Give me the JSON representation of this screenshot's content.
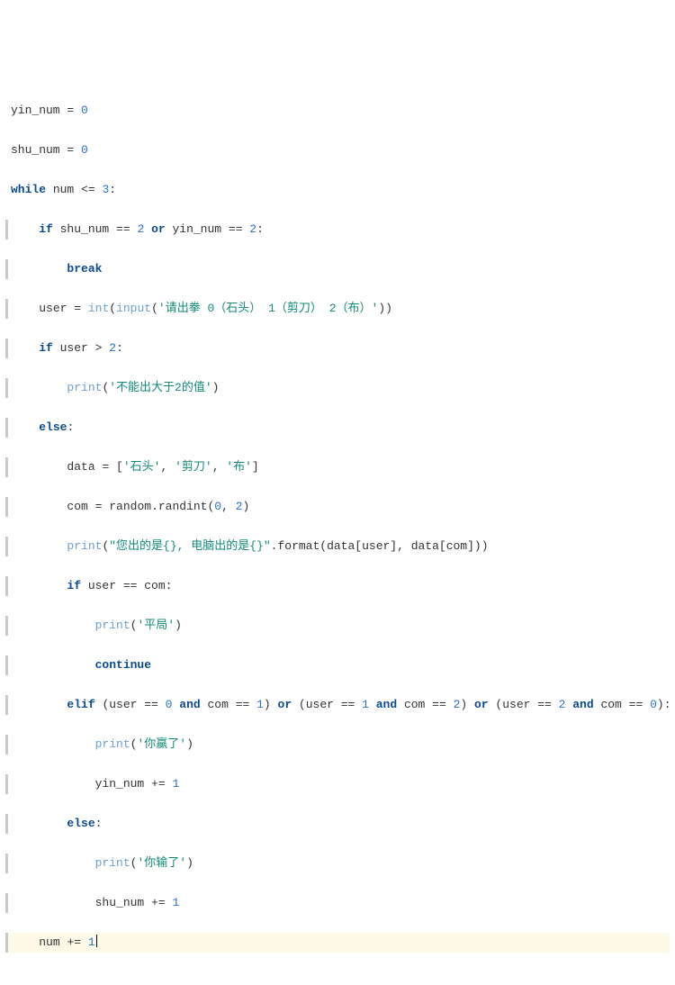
{
  "code": {
    "l0_yin": "yin_num ",
    "l0_eq": "= ",
    "l0_zero": "0",
    "l1_shu": "shu_num ",
    "l1_eq": "= ",
    "l1_zero": "0",
    "l2_while": "while",
    "l2_cond": " num ",
    "l2_le": "<=",
    "l2_num": " 3",
    "l2_colon": ":",
    "l3_if": "if",
    "l3_a": " shu_num ",
    "l3_eqeq1": "==",
    "l3_two1": " 2 ",
    "l3_or": "or",
    "l3_b": " yin_num ",
    "l3_eqeq2": "==",
    "l3_two2": " 2",
    "l3_colon": ":",
    "l4_break": "break",
    "l5_user": "user ",
    "l5_eq": "= ",
    "l5_int": "int",
    "l5_po": "(",
    "l5_input": "input",
    "l5_po2": "(",
    "l5_s": "'请出拳 0（石头） 1（剪刀） 2（布）'",
    "l5_pc": "))",
    "l6_if": "if",
    "l6_cond": " user ",
    "l6_gt": ">",
    "l6_two": " 2",
    "l6_colon": ":",
    "l7_print": "print",
    "l7_po": "(",
    "l7_s": "'不能出大于2的值'",
    "l7_pc": ")",
    "l8_else": "else",
    "l8_colon": ":",
    "l9_data": "data ",
    "l9_eq": "= ",
    "l9_lb": "[",
    "l9_s1": "'石头'",
    "l9_c1": ", ",
    "l9_s2": "'剪刀'",
    "l9_c2": ", ",
    "l9_s3": "'布'",
    "l9_rb": "]",
    "l10_com": "com ",
    "l10_eq": "= ",
    "l10_rand": "random.randint(",
    "l10_z": "0",
    "l10_c": ", ",
    "l10_t": "2",
    "l10_pc": ")",
    "l11_print": "print",
    "l11_po": "(",
    "l11_s": "\"您出的是{}, 电脑出的是{}\"",
    "l11_fmt": ".format(data[user], data[com]))",
    "l12_if": "if",
    "l12_cond": " user ",
    "l12_eqeq": "==",
    "l12_com": " com",
    "l12_colon": ":",
    "l13_print": "print",
    "l13_po": "(",
    "l13_s": "'平局'",
    "l13_pc": ")",
    "l14_continue": "continue",
    "l15_elif": "elif",
    "l15_a": " (user ",
    "l15_eq1": "==",
    "l15_z1": " 0 ",
    "l15_and1": "and",
    "l15_b": " com ",
    "l15_eq2": "==",
    "l15_o1": " 1",
    "l15_p1": ") ",
    "l15_or1": "or",
    "l15_c": " (user ",
    "l15_eq3": "==",
    "l15_o2": " 1 ",
    "l15_and2": "and",
    "l15_d": " com ",
    "l15_eq4": "==",
    "l15_t2": " 2",
    "l15_p2": ") ",
    "l15_or2": "or",
    "l15_e": " (user ",
    "l15_eq5": "==",
    "l15_t3": " 2 ",
    "l15_and3": "and",
    "l15_f": " com ",
    "l15_eq6": "==",
    "l15_z2": " 0",
    "l15_p3": ")",
    "l15_colon": ":",
    "l16_print": "print",
    "l16_po": "(",
    "l16_s": "'你赢了'",
    "l16_pc": ")",
    "l17_yin": "yin_num ",
    "l17_pe": "+=",
    "l17_one": " 1",
    "l18_else": "else",
    "l18_colon": ":",
    "l19_print": "print",
    "l19_po": "(",
    "l19_s": "'你输了'",
    "l19_pc": ")",
    "l20_shu": "shu_num ",
    "l20_pe": "+=",
    "l20_one": " 1",
    "l21_num": "num ",
    "l21_pe": "+=",
    "l21_one": " 1"
  }
}
